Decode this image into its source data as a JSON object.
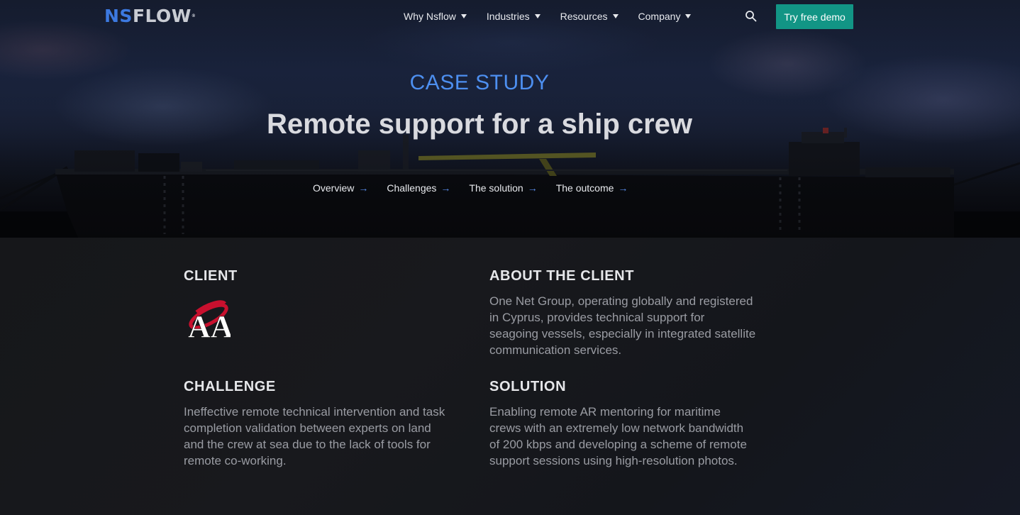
{
  "nav": {
    "logo_ns": "NS",
    "logo_flow": "FLOW",
    "logo_mark": "®",
    "menu": [
      {
        "label": "Why Nsflow"
      },
      {
        "label": "Industries"
      },
      {
        "label": "Resources"
      },
      {
        "label": "Company"
      }
    ],
    "search_icon": "search-icon",
    "demo_button": "Try free demo"
  },
  "hero": {
    "eyebrow": "CASE STUDY",
    "title": "Remote support for a ship crew",
    "anchors": [
      {
        "label": "Overview"
      },
      {
        "label": "Challenges"
      },
      {
        "label": "The solution"
      },
      {
        "label": "The outcome"
      }
    ],
    "arrow_glyph": "→"
  },
  "client": {
    "heading": "CLIENT",
    "logo_letters": "AA"
  },
  "about": {
    "heading": "ABOUT THE CLIENT",
    "lines": [
      "One Net Group, operating globally and registered",
      "in Cyprus, provides technical support for",
      "seagoing vessels, especially in integrated satellite",
      "communication services."
    ]
  },
  "challenge": {
    "heading": "CHALLENGE",
    "lines": [
      "Ineffective remote technical intervention and task",
      "completion validation between experts on land",
      "and the crew at sea due to the lack of tools for",
      "remote co-working."
    ]
  },
  "solution": {
    "heading": "SOLUTION",
    "lines": [
      "Enabling remote AR mentoring for maritime",
      "crews with an extremely low network bandwidth",
      "of 200 kbps and developing a scheme of remote",
      "support sessions using high-resolution photos."
    ]
  },
  "colors": {
    "accent_blue": "#4d8ff0",
    "button_teal": "#129585",
    "logo_red": "#c8102e"
  }
}
